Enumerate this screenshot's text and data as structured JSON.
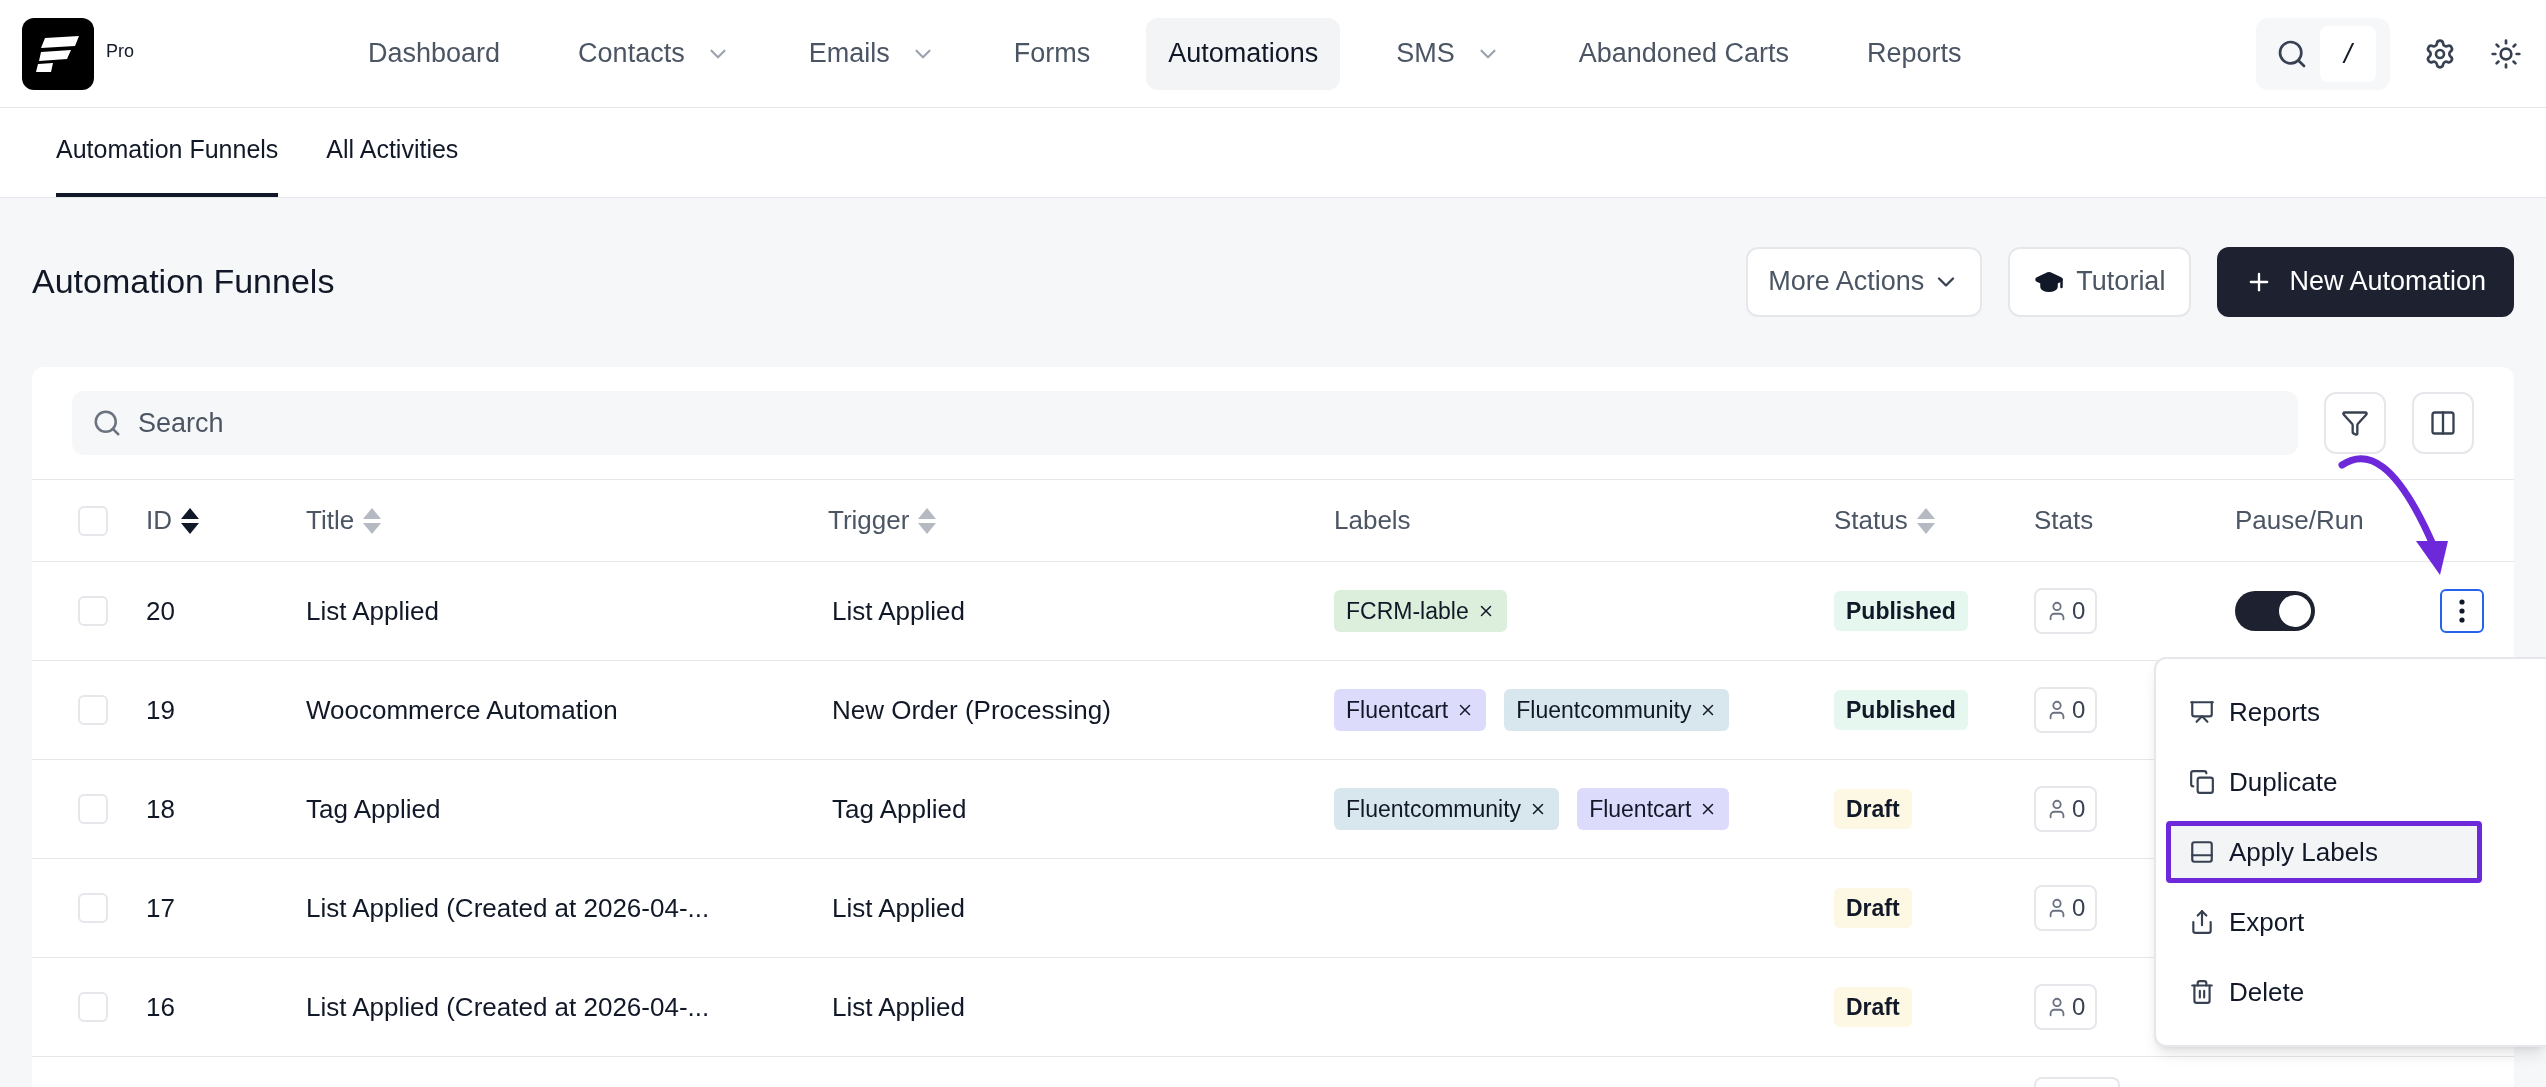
{
  "app": {
    "logo_badge": "Pro",
    "search_shortcut": "/",
    "nav": [
      {
        "label": "Dashboard",
        "dropdown": false,
        "selected": false
      },
      {
        "label": "Contacts",
        "dropdown": true,
        "selected": false
      },
      {
        "label": "Emails",
        "dropdown": true,
        "selected": false
      },
      {
        "label": "Forms",
        "dropdown": false,
        "selected": false
      },
      {
        "label": "Automations",
        "dropdown": false,
        "selected": true
      },
      {
        "label": "SMS",
        "dropdown": true,
        "selected": false
      },
      {
        "label": "Abandoned Carts",
        "dropdown": false,
        "selected": false
      },
      {
        "label": "Reports",
        "dropdown": false,
        "selected": false
      }
    ]
  },
  "subtabs": [
    {
      "label": "Automation Funnels",
      "selected": true
    },
    {
      "label": "All Activities",
      "selected": false
    }
  ],
  "page": {
    "title": "Automation Funnels",
    "buttons": [
      {
        "kind": "dropdown",
        "label": "More Actions"
      },
      {
        "kind": "tutorial",
        "label": "Tutorial"
      },
      {
        "kind": "primary",
        "label": "New Automation"
      }
    ]
  },
  "table": {
    "search": {
      "placeholder": "Search"
    },
    "select_all": {
      "checked": false
    },
    "columns": [
      {
        "label": "ID",
        "sorted": true
      },
      {
        "label": "Title",
        "sorted": false
      },
      {
        "label": "Trigger",
        "sorted": false
      },
      {
        "label": "Labels"
      },
      {
        "label": "Status",
        "sorted": false
      },
      {
        "label": "Stats"
      },
      {
        "label": "Pause/Run"
      }
    ],
    "rows": [
      {
        "checked": false,
        "id": "20",
        "title": "List Applied",
        "trigger": "List Applied",
        "labels": [
          {
            "text": "FCRM-lable",
            "color": "#dcefdc"
          }
        ],
        "status": {
          "kind": "published",
          "label": "Published"
        },
        "stats": "0",
        "running": true,
        "menu_open": true
      },
      {
        "checked": false,
        "id": "19",
        "title": "Woocommerce Automation",
        "trigger": "New Order (Processing)",
        "labels": [
          {
            "text": "Fluentcart",
            "color": "#dddbfb"
          },
          {
            "text": "Fluentcommunity",
            "color": "#d8e7ee"
          }
        ],
        "status": {
          "kind": "published",
          "label": "Published"
        },
        "stats": "0"
      },
      {
        "checked": false,
        "id": "18",
        "title": "Tag Applied",
        "trigger": "Tag Applied",
        "labels": [
          {
            "text": "Fluentcommunity",
            "color": "#d8e7ee"
          },
          {
            "text": "Fluentcart",
            "color": "#dddbfb"
          }
        ],
        "status": {
          "kind": "draft",
          "label": "Draft"
        },
        "stats": "0"
      },
      {
        "checked": false,
        "id": "17",
        "title": "List Applied (Created at 2026-04-...",
        "trigger": "List Applied",
        "labels": [],
        "status": {
          "kind": "draft",
          "label": "Draft"
        },
        "stats": "0"
      },
      {
        "checked": false,
        "id": "16",
        "title": "List Applied (Created at 2026-04-...",
        "trigger": "List Applied",
        "labels": [],
        "status": {
          "kind": "draft",
          "label": "Draft"
        },
        "stats": "0"
      }
    ]
  },
  "row_menu": {
    "items": [
      {
        "kind": "reports",
        "label": "Reports",
        "highlighted": false
      },
      {
        "kind": "duplicate",
        "label": "Duplicate",
        "highlighted": false
      },
      {
        "kind": "labels",
        "label": "Apply Labels",
        "highlighted": true
      },
      {
        "kind": "export",
        "label": "Export",
        "highlighted": false
      },
      {
        "kind": "delete",
        "label": "Delete",
        "highlighted": false
      }
    ]
  }
}
